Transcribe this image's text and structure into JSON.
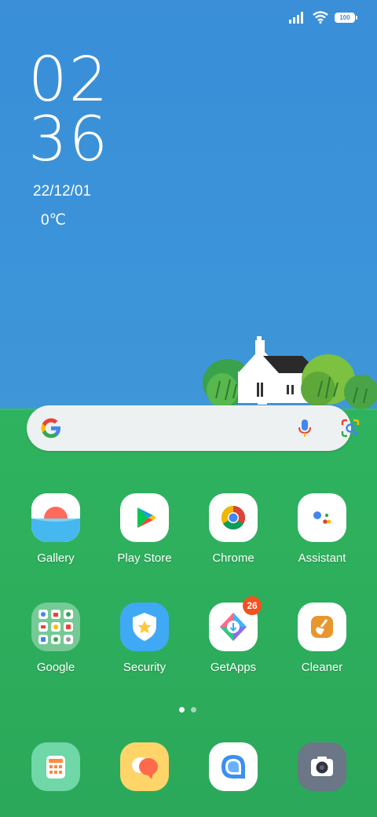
{
  "status": {
    "battery": "100"
  },
  "clock": {
    "hours": "02",
    "minutes": "36",
    "date": "22/12/01",
    "temp": "0℃"
  },
  "search": {
    "g_icon": "google-icon",
    "mic_icon": "mic-icon",
    "lens_icon": "lens-icon"
  },
  "apps_row1": [
    {
      "label": "Gallery",
      "icon": "gallery-icon"
    },
    {
      "label": "Play Store",
      "icon": "play-store-icon"
    },
    {
      "label": "Chrome",
      "icon": "chrome-icon"
    },
    {
      "label": "Assistant",
      "icon": "assistant-icon"
    }
  ],
  "apps_row2": [
    {
      "label": "Google",
      "icon": "google-folder-icon"
    },
    {
      "label": "Security",
      "icon": "security-icon"
    },
    {
      "label": "GetApps",
      "icon": "getapps-icon",
      "badge": "26"
    },
    {
      "label": "Cleaner",
      "icon": "cleaner-icon"
    }
  ],
  "dock": [
    {
      "icon": "calculator-icon"
    },
    {
      "icon": "messages-icon"
    },
    {
      "icon": "chat-icon"
    },
    {
      "icon": "camera-icon"
    }
  ],
  "colors": {
    "sky": "#3a8fd8",
    "grass": "#2fb35f",
    "badge": "#f4511e"
  }
}
